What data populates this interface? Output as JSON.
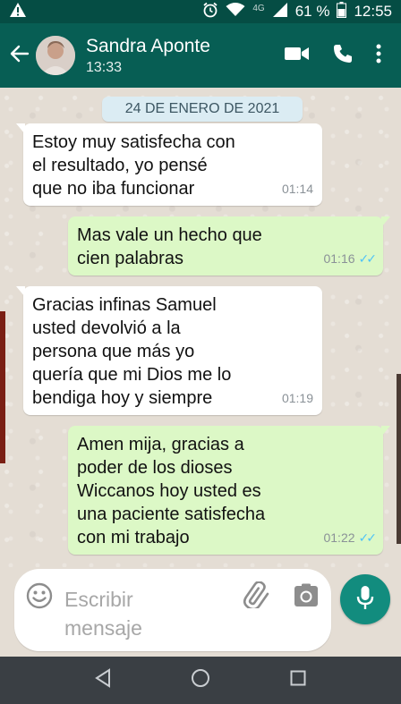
{
  "status_bar": {
    "battery": "61 %",
    "time": "12:55",
    "network": "4G"
  },
  "header": {
    "contact_name": "Sandra Aponte",
    "last_seen": "13:33"
  },
  "chat": {
    "date": "24 DE ENERO DE 2021",
    "messages": [
      {
        "direction": "in",
        "text": "Estoy muy satisfecha con\nel resultado, yo pensé\nque no iba funcionar",
        "time": "01:14"
      },
      {
        "direction": "out",
        "text": "Mas vale un hecho que\ncien palabras",
        "time": "01:16"
      },
      {
        "direction": "in",
        "text": "Gracias infinas Samuel\nusted devolvió a la\npersona que más yo\nquería que mi Dios me lo\nbendiga hoy y siempre",
        "time": "01:19"
      },
      {
        "direction": "out",
        "text": "Amen mija, gracias a\npoder de los dioses\nWiccanos hoy usted es\nuna paciente satisfecha\ncon mi trabajo",
        "time": "01:22"
      }
    ]
  },
  "composer": {
    "placeholder": "Escribir\nmensaje"
  },
  "colors": {
    "header": "#075e54",
    "status_bar": "#054d44",
    "outgoing_bubble": "#dcf8c6",
    "incoming_bubble": "#ffffff",
    "mic_button": "#128c7e",
    "read_ticks": "#4fc3f7"
  },
  "icons": {
    "status_left": "warning-icon",
    "status_right": [
      "alarm-icon",
      "wifi-icon",
      "signal-icon",
      "battery-icon"
    ],
    "header": [
      "back-arrow-icon",
      "video-call-icon",
      "phone-icon",
      "more-vert-icon"
    ],
    "composer": [
      "emoji-icon",
      "attach-icon",
      "camera-icon",
      "mic-icon"
    ],
    "nav": [
      "nav-back-icon",
      "nav-home-icon",
      "nav-recents-icon"
    ]
  }
}
